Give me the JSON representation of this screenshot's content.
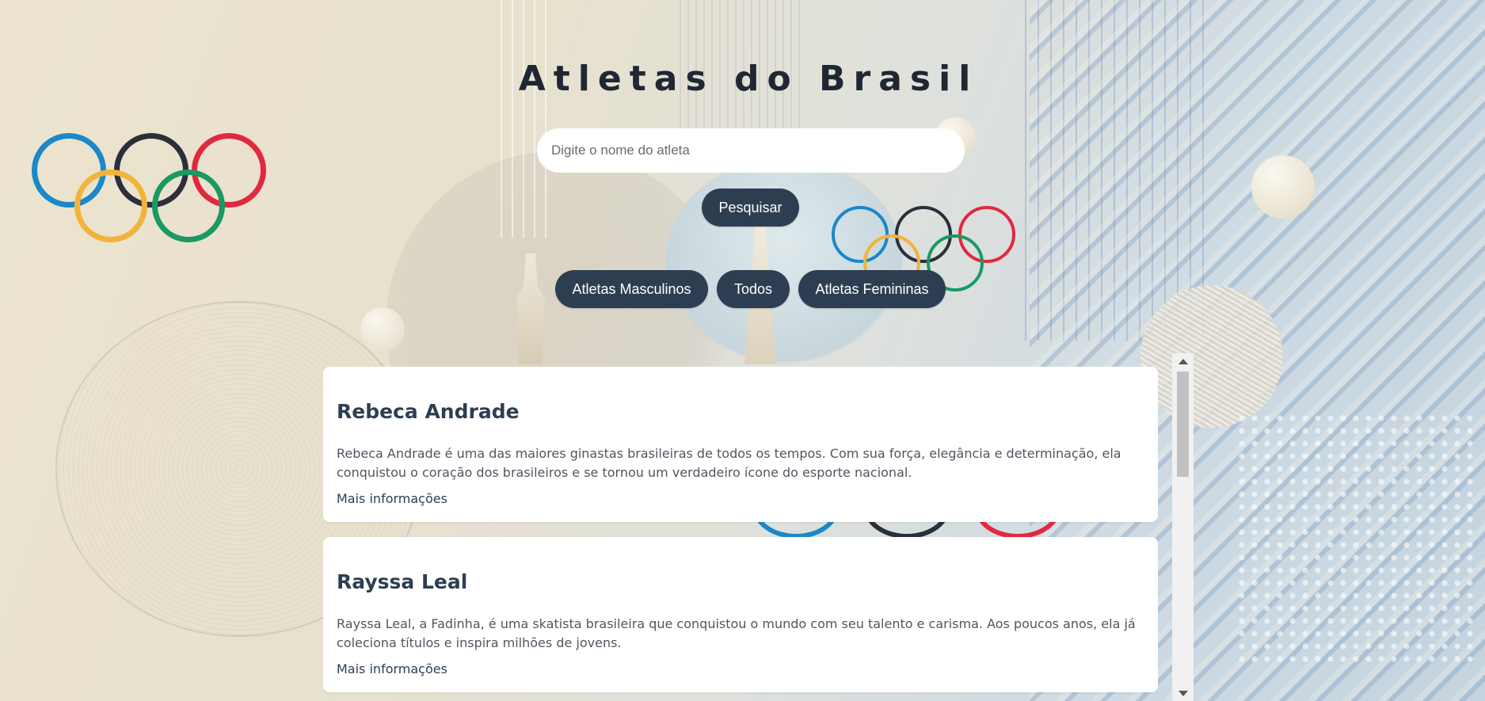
{
  "header": {
    "title": "Atletas do Brasil"
  },
  "search": {
    "placeholder": "Digite o nome do atleta",
    "value": "",
    "button_label": "Pesquisar"
  },
  "filters": [
    {
      "label": "Atletas Masculinos"
    },
    {
      "label": "Todos"
    },
    {
      "label": "Atletas Femininas"
    }
  ],
  "athletes": [
    {
      "name": "Rebeca Andrade",
      "description": "Rebeca Andrade é uma das maiores ginastas brasileiras de todos os tempos. Com sua força, elegância e determinação, ela conquistou o coração dos brasileiros e se tornou um verdadeiro ícone do esporte nacional.",
      "link_label": "Mais informações"
    },
    {
      "name": "Rayssa Leal",
      "description": "Rayssa Leal, a Fadinha, é uma skatista brasileira que conquistou o mundo com seu talento e carisma. Aos poucos anos, ela já coleciona títulos e inspira milhões de jovens.",
      "link_label": "Mais informações"
    }
  ],
  "colors": {
    "button_bg": "#2e3e52",
    "title_text": "#1f2733",
    "card_title": "#2e3e52",
    "olympic_blue": "#1a88c9",
    "olympic_black": "#2b2f3a",
    "olympic_red": "#e2283f",
    "olympic_yellow": "#f3b23a",
    "olympic_green": "#1a9a62"
  }
}
